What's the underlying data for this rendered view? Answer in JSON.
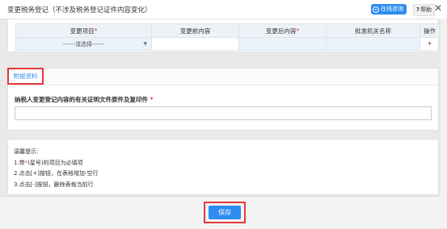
{
  "window": {
    "title": "变更税务登记（不涉及税务登记证件内容变化）",
    "online_consult_label": "在线咨询",
    "help_label": "帮助",
    "help_mark": "?",
    "close_glyph": "✕"
  },
  "change_table": {
    "headers": [
      {
        "label": "变更项目",
        "required": true
      },
      {
        "label": "变更前内容",
        "required": false
      },
      {
        "label": "变更后内容",
        "required": true
      },
      {
        "label": "批准机关名称",
        "required": false
      },
      {
        "label": "操作",
        "required": false
      }
    ],
    "required_mark": "*",
    "row": {
      "select_value": "------请选择------",
      "before": "",
      "after": "",
      "authority": "",
      "add_glyph": "+"
    }
  },
  "attachments": {
    "tab_label": "附报资料",
    "proof_label": "纳税人变更登记内容的有关证明文件原件及复印件",
    "proof_required_mark": "*",
    "proof_value": ""
  },
  "tips": {
    "title": "温馨提示:",
    "line1_prefix": "1.带",
    "line1_mark": "*",
    "line1_suffix": "(星号)的项目为必填项",
    "line2": "2.点击[+]按钮，在表格增加-空行",
    "line3": "3.点击[-]按钮，删除表格当前行"
  },
  "footer": {
    "save_label": "保存"
  },
  "colors": {
    "accent": "#2d8cf0",
    "required": "#e4393c",
    "highlight_border": "#e4393c"
  }
}
